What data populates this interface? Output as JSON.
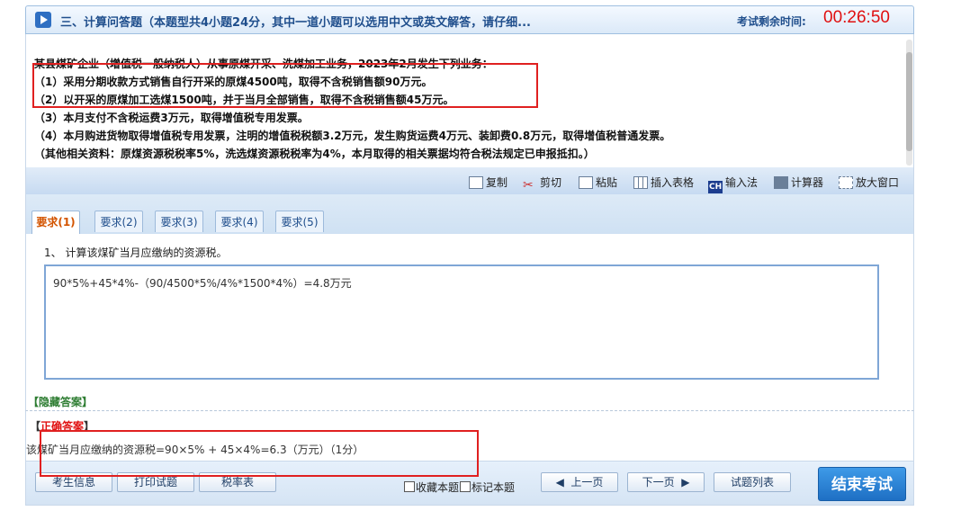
{
  "header": {
    "section_title": "三、计算问答题（本题型共4小题24分，其中一道小题可以选用中文或英文解答，请仔细...",
    "time_label": "考试剩余时间:",
    "time_value": "00:26:50"
  },
  "question": {
    "lines": [
      "某县煤矿企业（增值税一般纳税人）从事原煤开采、洗煤加工业务，2023年2月发生下列业务：",
      "（1）采用分期收款方式销售自行开采的原煤4500吨，取得不含税销售额90万元。",
      "（2）以开采的原煤加工选煤1500吨，并于当月全部销售，取得不含税销售额45万元。",
      "（3）本月支付不含税运费3万元，取得增值税专用发票。",
      "（4）本月购进货物取得增值税专用发票，注明的增值税税额3.2万元，发生购货运费4万元、装卸费0.8万元，取得增值税普通发票。",
      "（其他相关资料：原煤资源税税率5%，洗选煤资源税税率为4%，本月取得的相关票据均符合税法规定已申报抵扣。）"
    ]
  },
  "toolbar": {
    "copy": "复制",
    "cut": "剪切",
    "paste": "粘贴",
    "insert_table": "插入表格",
    "ime": "输入法",
    "ime_icon": "CH",
    "calculator": "计算器",
    "maximize": "放大窗口"
  },
  "tabs": [
    "要求(1)",
    "要求(2)",
    "要求(3)",
    "要求(4)",
    "要求(5)"
  ],
  "requirement": {
    "text": "1、 计算该煤矿当月应缴纳的资源税。",
    "answer": "90*5%+45*4%-（90/4500*5%/4%*1500*4%）=4.8万元"
  },
  "hidden_answer": "【隐藏答案】",
  "correct": {
    "bracket_left": "【",
    "label": "正确答案",
    "bracket_right": "】",
    "text": "该煤矿当月应缴纳的资源税=90×5% + 45×4%=6.3（万元）（1分）"
  },
  "footer": {
    "candidate_info": "考生信息",
    "print": "打印试题",
    "tax_rate": "税率表",
    "bookmark": "收藏本题",
    "mark": "标记本题",
    "prev": "上一页",
    "next": "下一页",
    "question_list": "试题列表",
    "end_exam": "结束考试"
  }
}
